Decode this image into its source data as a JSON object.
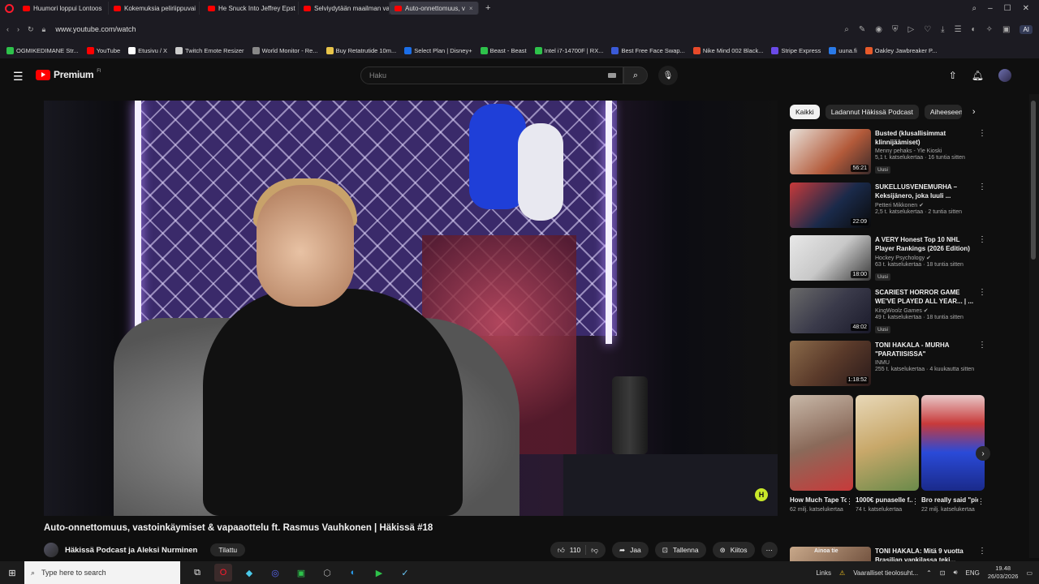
{
  "browser": {
    "tabs": [
      {
        "label": "Huumori loppui Lontoos",
        "active": false
      },
      {
        "label": "Kokemuksia peliriippuvai",
        "active": false
      },
      {
        "label": "He Snuck Into Jeffrey Epst",
        "active": false
      },
      {
        "label": "Selviydytään maailman va",
        "active": false
      },
      {
        "label": "Auto-onnettomuus, v",
        "active": true
      }
    ],
    "url": "www.youtube.com/watch",
    "ai_label": "AI",
    "bookmarks": [
      {
        "label": "OGMIKEDIMANE Str...",
        "color": "#2ec24b"
      },
      {
        "label": "YouTube",
        "color": "#ff0000"
      },
      {
        "label": "Etusivu / X",
        "color": "#ffffff"
      },
      {
        "label": "Twitch Emote Resizer",
        "color": "#cccccc"
      },
      {
        "label": "World Monitor - Re...",
        "color": "#888888"
      },
      {
        "label": "Buy Retatrutide 10m...",
        "color": "#e8c44a"
      },
      {
        "label": "Select Plan | Disney+",
        "color": "#1b6ee8"
      },
      {
        "label": "Beast - Beast",
        "color": "#2ec24b"
      },
      {
        "label": "Intel i7-14700F | RX...",
        "color": "#2ec24b"
      },
      {
        "label": "Best Free Face Swap...",
        "color": "#3a5ad8"
      },
      {
        "label": "Nike Mind 002 Black...",
        "color": "#e84a2a"
      },
      {
        "label": "Stripe Express",
        "color": "#6a4ae8"
      },
      {
        "label": "uuna.fi",
        "color": "#2a7ae8"
      },
      {
        "label": "Oakley Jawbreaker P...",
        "color": "#e85a2a"
      }
    ]
  },
  "header": {
    "brand": "Premium",
    "brand_region": "FI",
    "search_placeholder": "Haku"
  },
  "video": {
    "title": "Auto-onnettomuus, vastoinkäymiset & vapaaottelu ft. Rasmus Vauhkonen | Häkissä #18",
    "channel": "Häkissä Podcast ja Aleksi Nurminen",
    "subscribe_label": "Tilattu",
    "likes": "110",
    "share_label": "Jaa",
    "save_label": "Tallenna",
    "thanks_label": "Kiitos",
    "overlay_badge": "H"
  },
  "chips": [
    "Kaikki",
    "Ladannut Häkissä Podcast",
    "Aiheeseen"
  ],
  "recommendations": [
    {
      "title": "Busted (klusallisimmat klinnijäämiset)",
      "channel": "Menny pehaks - Yle Kioski",
      "views": "5,1 t. katselukertaa · 16 tuntia sitten",
      "duration": "56:21",
      "new": "Uusi",
      "thumb": "#b35a3a"
    },
    {
      "title": "SUKELLUSVENEMURHA – Keksijänero, joka luuli ...",
      "channel": "Petteri Mikkonen",
      "views": "2,5 t. katselukertaa · 2 tuntia sitten",
      "duration": "22:09",
      "new": "",
      "thumb": "#c83a3a"
    },
    {
      "title": "A VERY Honest Top 10 NHL Player Rankings (2026 Edition)",
      "channel": "Hockey Psychology",
      "views": "63 t. katselukertaa · 18 tuntia sitten",
      "duration": "18:00",
      "new": "Uusi",
      "thumb": "#d8d8d8"
    },
    {
      "title": "SCARIEST HORROR GAME WE'VE PLAYED ALL YEAR... | ...",
      "channel": "KingWoolz Games",
      "views": "49 t. katselukertaa · 18 tuntia sitten",
      "duration": "48:02",
      "new": "Uusi",
      "thumb": "#3a3a4a"
    },
    {
      "title": "TONI HAKALA - MURHA \"PARATIISISSA\"",
      "channel": "INMU",
      "views": "255 t. katselukertaa · 4 kuukautta sitten",
      "duration": "1:18:52",
      "new": "",
      "thumb": "#5a3a2a"
    }
  ],
  "shorts": [
    {
      "title": "How Much Tape To Sto...",
      "views": "62 milj. katselukertaa",
      "thumb": "#8a6a5a"
    },
    {
      "title": "1000€ punaselle f...",
      "views": "74 t. katselukertaa",
      "thumb": "#c8a86a"
    },
    {
      "title": "Bro really said \"picker...",
      "views": "22 milj. katselukertaa",
      "thumb": "#2a4ad8"
    }
  ],
  "next_rec": {
    "title": "TONI HAKALA: Mitä 9 vuotta Brasilian vankilassa teki...",
    "thumb_text": "Ainoa tie"
  },
  "taskbar": {
    "search_placeholder": "Type here to search",
    "links_label": "Links",
    "warning_label": "Vaaralliset tieolosuht...",
    "lang": "ENG",
    "time": "19.48",
    "date": "26/03/2026"
  }
}
